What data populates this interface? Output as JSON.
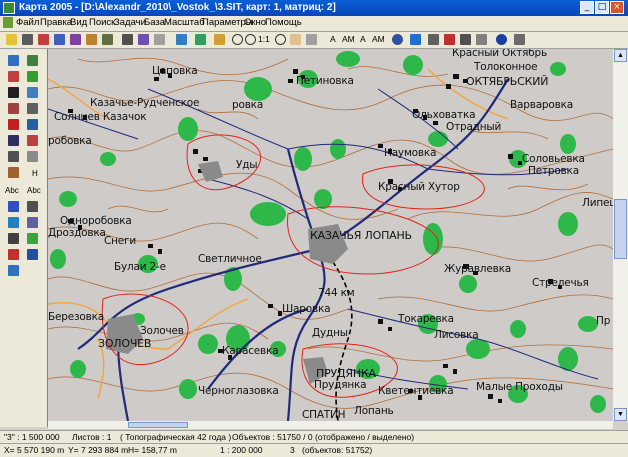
{
  "window": {
    "title": "Карта 2005 - [D:\\Alexandr_2010\\_Vostok_\\3.SIT, карт: 1, матриц: 2]"
  },
  "menu": [
    "Файл",
    "Правка",
    "Вид",
    "Поиск",
    "Задачи",
    "База",
    "Масштаб",
    "Параметры",
    "Окно",
    "Помощь"
  ],
  "toolbar": {
    "zoom_label": "1:1",
    "text_tools": [
      "A",
      "AM",
      "A",
      "AM"
    ]
  },
  "left_tools": {
    "abc1": "Abc",
    "abc2": "Abc",
    "h_label": "H"
  },
  "map": {
    "labels": {
      "tsapovka": "Цаповка",
      "petinovka": "Петиновка",
      "krasny_oktyabr": "Красный Октябрь",
      "tolokonnoe": "Толоконное",
      "oktyabrsky": "ОКТЯБРЬСКИЙ",
      "kazache_rudchenskoe": "Казачье-Рудченское",
      "solntsev_kazachok": "Солнцев Казачок",
      "varvarovka": "Варваровка",
      "olkovatka": "Ольховатка",
      "otradny": "Отрадный",
      "rovka": "ровка",
      "robovka": "робовка",
      "udy": "Уды",
      "naumovka": "Наумовка",
      "solovyovka": "Соловьевка",
      "petrovka": "Петровка",
      "krasny_khutor": "Красный Хутор",
      "odnorobovka": "Одноробовка",
      "drozdy": "Дроздовка",
      "snegi": "Снеги",
      "kozachya_lopan": "КАЗАЧЬЯ ЛОПАНЬ",
      "lipets": "Липец",
      "zhuravlevka": "Журавлевка",
      "bulai": "Булаи 2-е",
      "svetlichnoe": "Светличное",
      "strelechya": "Стрелечья",
      "km744": "744 км",
      "bereozovka": "Березовка",
      "zolochev": "Золочев",
      "zolochev_caps": "ЗОЛОЧЕВ",
      "sharovka": "Шаровка",
      "tokarevka": "Токаревка",
      "lisovka": "Лисовка",
      "pr": "Пр",
      "karasevka": "Карасевка",
      "dudny": "Дудны",
      "prudyanka_caps": "ПРУДЯНКА",
      "prudyanka": "Прудянка",
      "mal_prokhody": "Малые Проходы",
      "chernoglazovka": "Черноглазовка",
      "lopan": "Лопань",
      "spatin": "СПАТИН",
      "kvitentievka": "Кветентиевка"
    }
  },
  "status1": {
    "scale": "\"3\" : 1 500 000",
    "sheets": "Листов : 1",
    "topo": "( Топографическая 42 года )",
    "objects": "Объектов : 51750 / 0 (отображено / выделено)"
  },
  "status2": {
    "x": "X=  5 570 190 m",
    "y": "Y=  7 293 884 m",
    "h": "H= 158,77 m",
    "scale": "1 : 200 000",
    "layer": "3",
    "objects": "(объектов: 51752)"
  },
  "colors": {
    "map_bg": "#cfcbc8",
    "forest": "#2fb84a",
    "contour": "#b0703c",
    "road": "#1f2a7a",
    "highlight": "#e0241c",
    "orange_road": "#f4a43a"
  }
}
